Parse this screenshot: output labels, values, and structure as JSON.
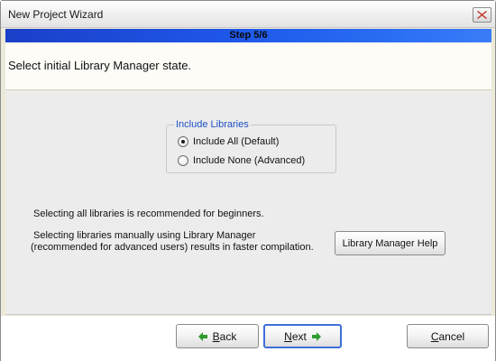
{
  "window": {
    "title": "New Project Wizard"
  },
  "step": {
    "label": "Step 5/6"
  },
  "header": {
    "instruction": "Select initial Library Manager state."
  },
  "libraries_group": {
    "legend": "Include Libraries",
    "options": [
      {
        "label": "Include All (Default)",
        "checked": true
      },
      {
        "label": "Include None (Advanced)",
        "checked": false
      }
    ]
  },
  "info": {
    "line1": "Selecting all libraries is recommended for beginners.",
    "line2a": "Selecting libraries manually using Library Manager",
    "line2b": "(recommended for advanced users) results in faster compilation."
  },
  "buttons": {
    "help": "Library Manager Help",
    "back_prefix": "B",
    "back_rest": "ack",
    "next_prefix": "N",
    "next_rest": "ext",
    "cancel_prefix": "C",
    "cancel_rest": "ancel"
  },
  "icons": {
    "close": "close-icon",
    "back_arrow": "arrow-left-icon",
    "next_arrow": "arrow-right-icon"
  },
  "colors": {
    "step_bar": "#1e56e8",
    "legend_text": "#1c4fc6",
    "arrow_green": "#2e9c2e",
    "close_red": "#c0392b"
  }
}
